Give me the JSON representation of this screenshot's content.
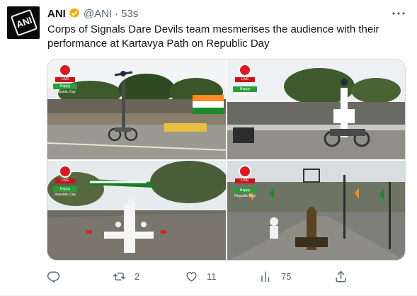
{
  "tweet": {
    "author_name": "ANI",
    "author_handle": "@ANI",
    "separator": "·",
    "time": "53s",
    "avatar_text": "ANI",
    "text": "Corps of Signals Dare Devils team mesmerises the audience with their performance at Kartavya Path on Republic Day",
    "verified_color": "#e8b007"
  },
  "media": {
    "overlay_badge": "Happy Republic Day",
    "live_text": "LIVE"
  },
  "actions": {
    "reply_count": "",
    "retweet_count": "2",
    "like_count": "11",
    "views_count": "75"
  },
  "icons": {
    "reply": "reply-icon",
    "retweet": "retweet-icon",
    "like": "heart-icon",
    "views": "views-icon",
    "share": "share-icon",
    "more": "more-icon"
  }
}
